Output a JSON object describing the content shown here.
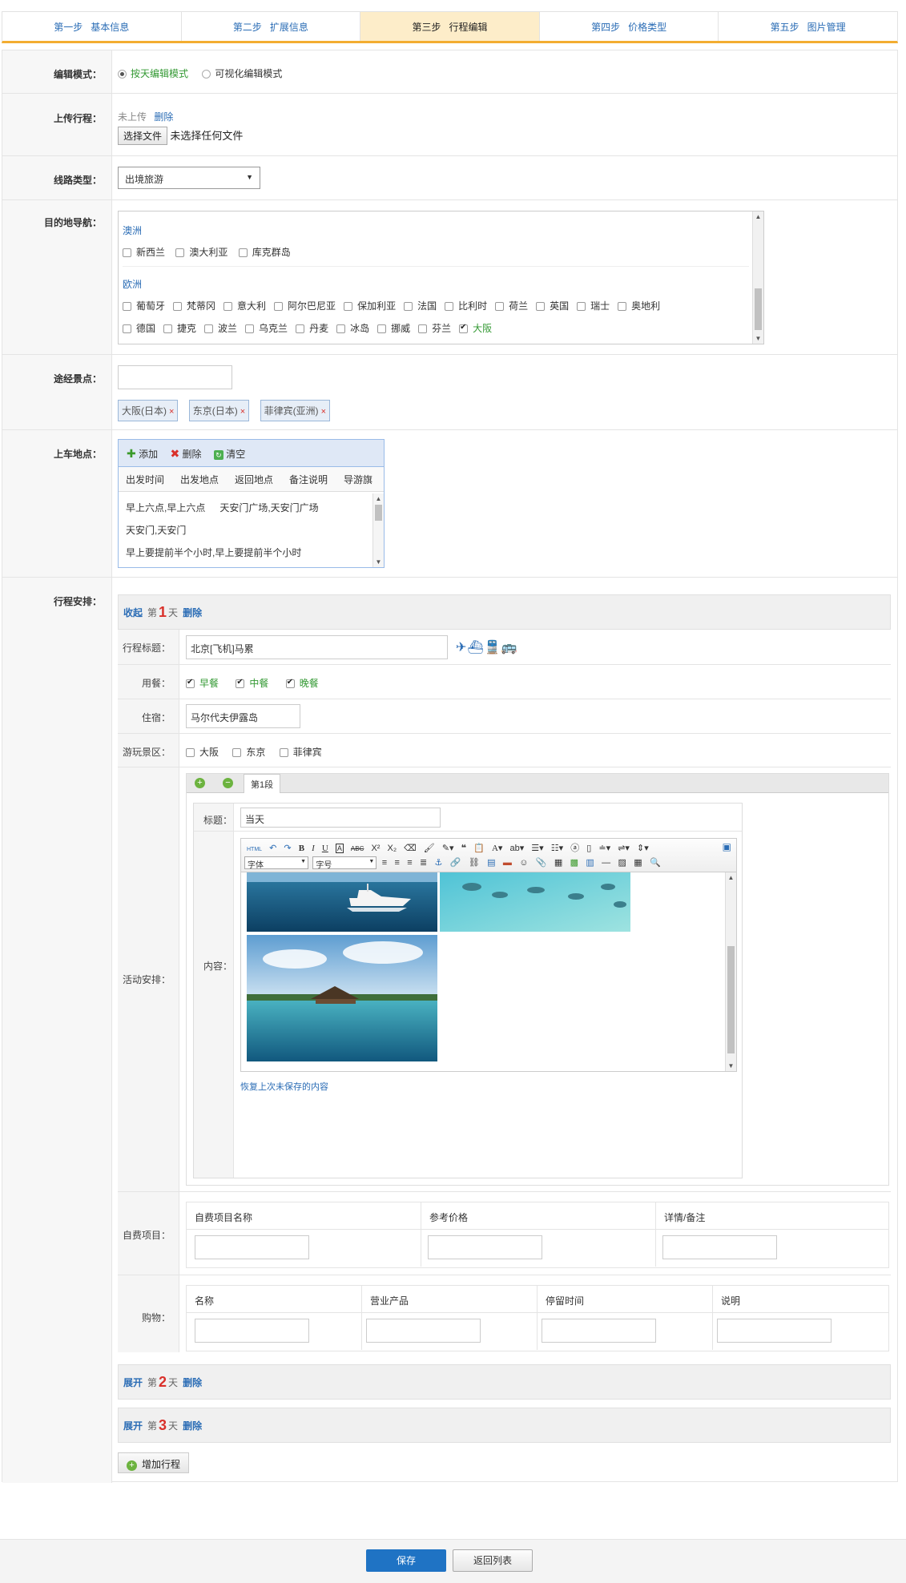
{
  "steps": [
    {
      "n": "第一步",
      "t": "基本信息"
    },
    {
      "n": "第二步",
      "t": "扩展信息"
    },
    {
      "n": "第三步",
      "t": "行程编辑"
    },
    {
      "n": "第四步",
      "t": "价格类型"
    },
    {
      "n": "第五步",
      "t": "图片管理"
    }
  ],
  "labels": {
    "edit_mode": "编辑模式：",
    "upload": "上传行程：",
    "line_type": "线路类型：",
    "dest": "目的地导航：",
    "via": "途经景点：",
    "boarding": "上车地点：",
    "schedule": "行程安排："
  },
  "edit_mode": {
    "opt1": "按天编辑模式",
    "opt2": "可视化编辑模式"
  },
  "upload": {
    "status": "未上传",
    "delete": "删除",
    "choose": "选择文件",
    "none": "未选择任何文件"
  },
  "line_type": {
    "value": "出境旅游"
  },
  "dest": {
    "region1": "澳洲",
    "items1": [
      "新西兰",
      "澳大利亚",
      "库克群岛"
    ],
    "region2": "欧洲",
    "items2a": [
      "葡萄牙",
      "梵蒂冈",
      "意大利",
      "阿尔巴尼亚",
      "保加利亚",
      "法国",
      "比利时",
      "荷兰",
      "英国",
      "瑞士",
      "奥地利"
    ],
    "items2b": [
      "德国",
      "捷克",
      "波兰",
      "乌克兰",
      "丹麦",
      "冰岛",
      "挪威",
      "芬兰",
      "大阪"
    ]
  },
  "via": {
    "tags": [
      "大阪(日本)",
      "东京(日本)",
      "菲律宾(亚洲)"
    ]
  },
  "boarding": {
    "add": "添加",
    "del": "删除",
    "clear": "清空",
    "cols": [
      "出发时间",
      "出发地点",
      "返回地点",
      "备注说明",
      "导游旗"
    ],
    "rows": [
      "早上六点,早上六点",
      "天安门广场,天安门广场",
      "天安门,天安门",
      "早上要提前半个小时,早上要提前半个小时"
    ]
  },
  "day1": {
    "collapse": "收起",
    "pre": "第",
    "num": "1",
    "post": "天",
    "del": "删除",
    "title_label": "行程标题：",
    "title": "北京[飞机]马累",
    "meal_label": "用餐：",
    "meals": [
      "早餐",
      "中餐",
      "晚餐"
    ],
    "stay_label": "住宿：",
    "stay": "马尔代夫伊露岛",
    "spot_label": "游玩景区：",
    "spots": [
      "大阪",
      "东京",
      "菲律宾"
    ],
    "act_label": "活动安排：",
    "seg": "第1段",
    "seg_title_label": "标题：",
    "seg_title": "当天",
    "content_label": "内容：",
    "font": "字体",
    "size": "字号",
    "restore": "恢复上次未保存的内容",
    "self_label": "自费项目：",
    "self_cols": [
      "自费项目名称",
      "参考价格",
      "详情/备注"
    ],
    "shop_label": "购物：",
    "shop_cols": [
      "名称",
      "营业产品",
      "停留时间",
      "说明"
    ]
  },
  "day2": {
    "expand": "展开",
    "pre": "第",
    "num": "2",
    "post": "天",
    "del": "删除"
  },
  "day3": {
    "expand": "展开",
    "pre": "第",
    "num": "3",
    "post": "天",
    "del": "删除"
  },
  "add_day": "增加行程",
  "footer": {
    "save": "保存",
    "back": "返回列表"
  },
  "colors": {
    "accent": "#f3ad31",
    "link": "#2a6cb5",
    "save": "#1f73c4"
  }
}
